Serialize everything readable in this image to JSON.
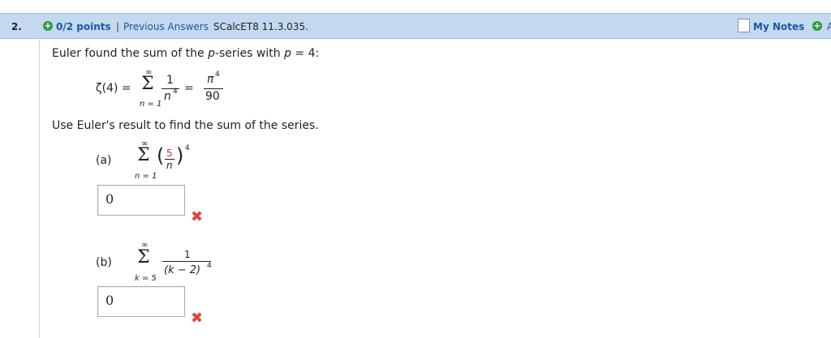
{
  "header": {
    "question_number": "2.",
    "points": "0/2 points",
    "separator": "|",
    "previous_answers": "Previous Answers",
    "source": "SCalcET8 11.3.035.",
    "my_notes": "My Notes",
    "cutoff_text": "A"
  },
  "problem": {
    "intro_prefix": "Euler found the sum of the ",
    "intro_p": "p",
    "intro_mid": "-series with ",
    "intro_p2": "p",
    "intro_suffix": " = 4:",
    "zeta_lhs": "ζ(4) =",
    "sum_upper": "∞",
    "sum_lower": "n = 1",
    "sigma": "Σ",
    "num_one": "1",
    "den_n": "n",
    "exp4": "4",
    "eq": "=",
    "pi": "π",
    "pi_exp": "4",
    "ninety": "90",
    "instruction": "Use Euler's result to find the sum of the series."
  },
  "part_a": {
    "label": "(a)",
    "sum_upper": "∞",
    "sum_lower": "n = 1",
    "sigma": "Σ",
    "lparen": "(",
    "rparen": ")",
    "num": "5",
    "den": "n",
    "exp": "4",
    "answer_value": "0",
    "status_icon": "✖"
  },
  "part_b": {
    "label": "(b)",
    "sum_upper": "∞",
    "sum_lower": "k = 5",
    "sigma": "Σ",
    "num": "1",
    "den": "(k − 2)",
    "exp": "4",
    "answer_value": "0",
    "status_icon": "✖"
  }
}
